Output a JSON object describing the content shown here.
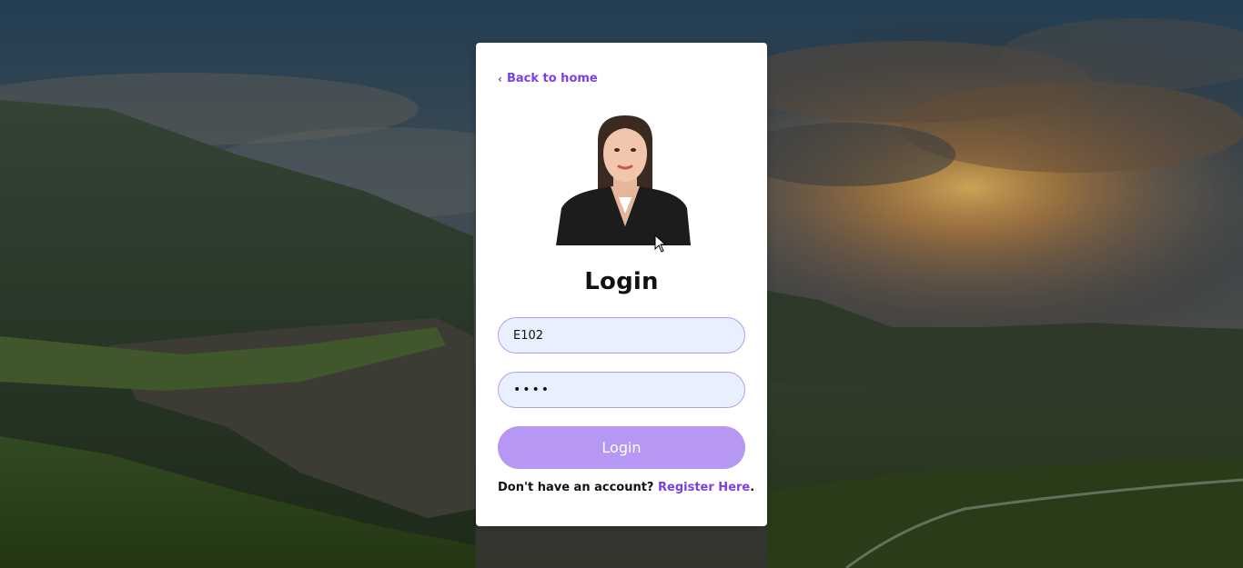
{
  "page": {
    "background_scene": "mountain-valley-sunset",
    "accent_color": "#7b3fe4",
    "button_color": "#b697f4",
    "input_bg_color": "#e8f0fe"
  },
  "login_card": {
    "back_link_icon": "chevron-left-icon",
    "back_link_label": "Back to home",
    "title": "Login",
    "username_value": "E102",
    "password_value": "••••",
    "login_button_label": "Login",
    "footer_prefix": "Don't have an account?",
    "register_link_label": "Register Here",
    "footer_suffix": "."
  }
}
